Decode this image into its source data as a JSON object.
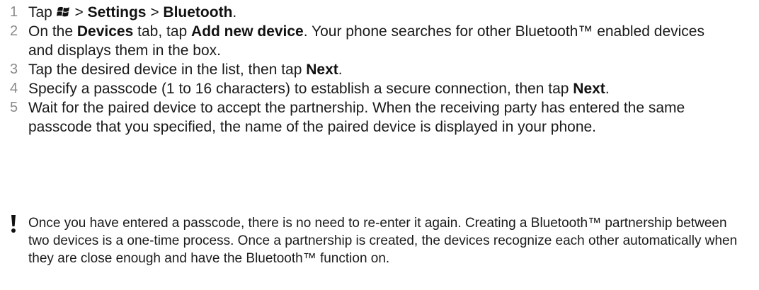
{
  "steps": [
    {
      "num": "1",
      "segments": [
        {
          "text": "Tap ",
          "bold": false
        },
        {
          "icon": "windows-start-icon"
        },
        {
          "text": " > ",
          "bold": false
        },
        {
          "text": "Settings",
          "bold": true
        },
        {
          "text": " > ",
          "bold": false
        },
        {
          "text": "Bluetooth",
          "bold": true
        },
        {
          "text": ".",
          "bold": false
        }
      ]
    },
    {
      "num": "2",
      "segments": [
        {
          "text": "On the ",
          "bold": false
        },
        {
          "text": "Devices",
          "bold": true
        },
        {
          "text": " tab, tap ",
          "bold": false
        },
        {
          "text": "Add new device",
          "bold": true
        },
        {
          "text": ". Your phone searches for other Bluetooth™ enabled devices and displays them in the box.",
          "bold": false
        }
      ]
    },
    {
      "num": "3",
      "segments": [
        {
          "text": "Tap the desired device in the list, then tap ",
          "bold": false
        },
        {
          "text": "Next",
          "bold": true
        },
        {
          "text": ".",
          "bold": false
        }
      ]
    },
    {
      "num": "4",
      "segments": [
        {
          "text": "Specify a passcode (1 to 16 characters) to establish a secure connection, then tap ",
          "bold": false
        },
        {
          "text": "Next",
          "bold": true
        },
        {
          "text": ".",
          "bold": false
        }
      ]
    },
    {
      "num": "5",
      "segments": [
        {
          "text": "Wait for the paired device to accept the partnership. When the receiving party has entered the same passcode that you specified, the name of the paired device is displayed in your phone.",
          "bold": false
        }
      ]
    }
  ],
  "note": {
    "icon": "exclamation-icon",
    "text": "Once you have entered a passcode, there is no need to re-enter it again. Creating a Bluetooth™ partnership between two devices is a one-time process. Once a partnership is created, the devices recognize each other automatically when they are close enough and have the Bluetooth™ function on."
  },
  "colors": {
    "step_number": "#8a8a8a",
    "heading_red": "#e3001b",
    "text": "#1a1a1a"
  }
}
